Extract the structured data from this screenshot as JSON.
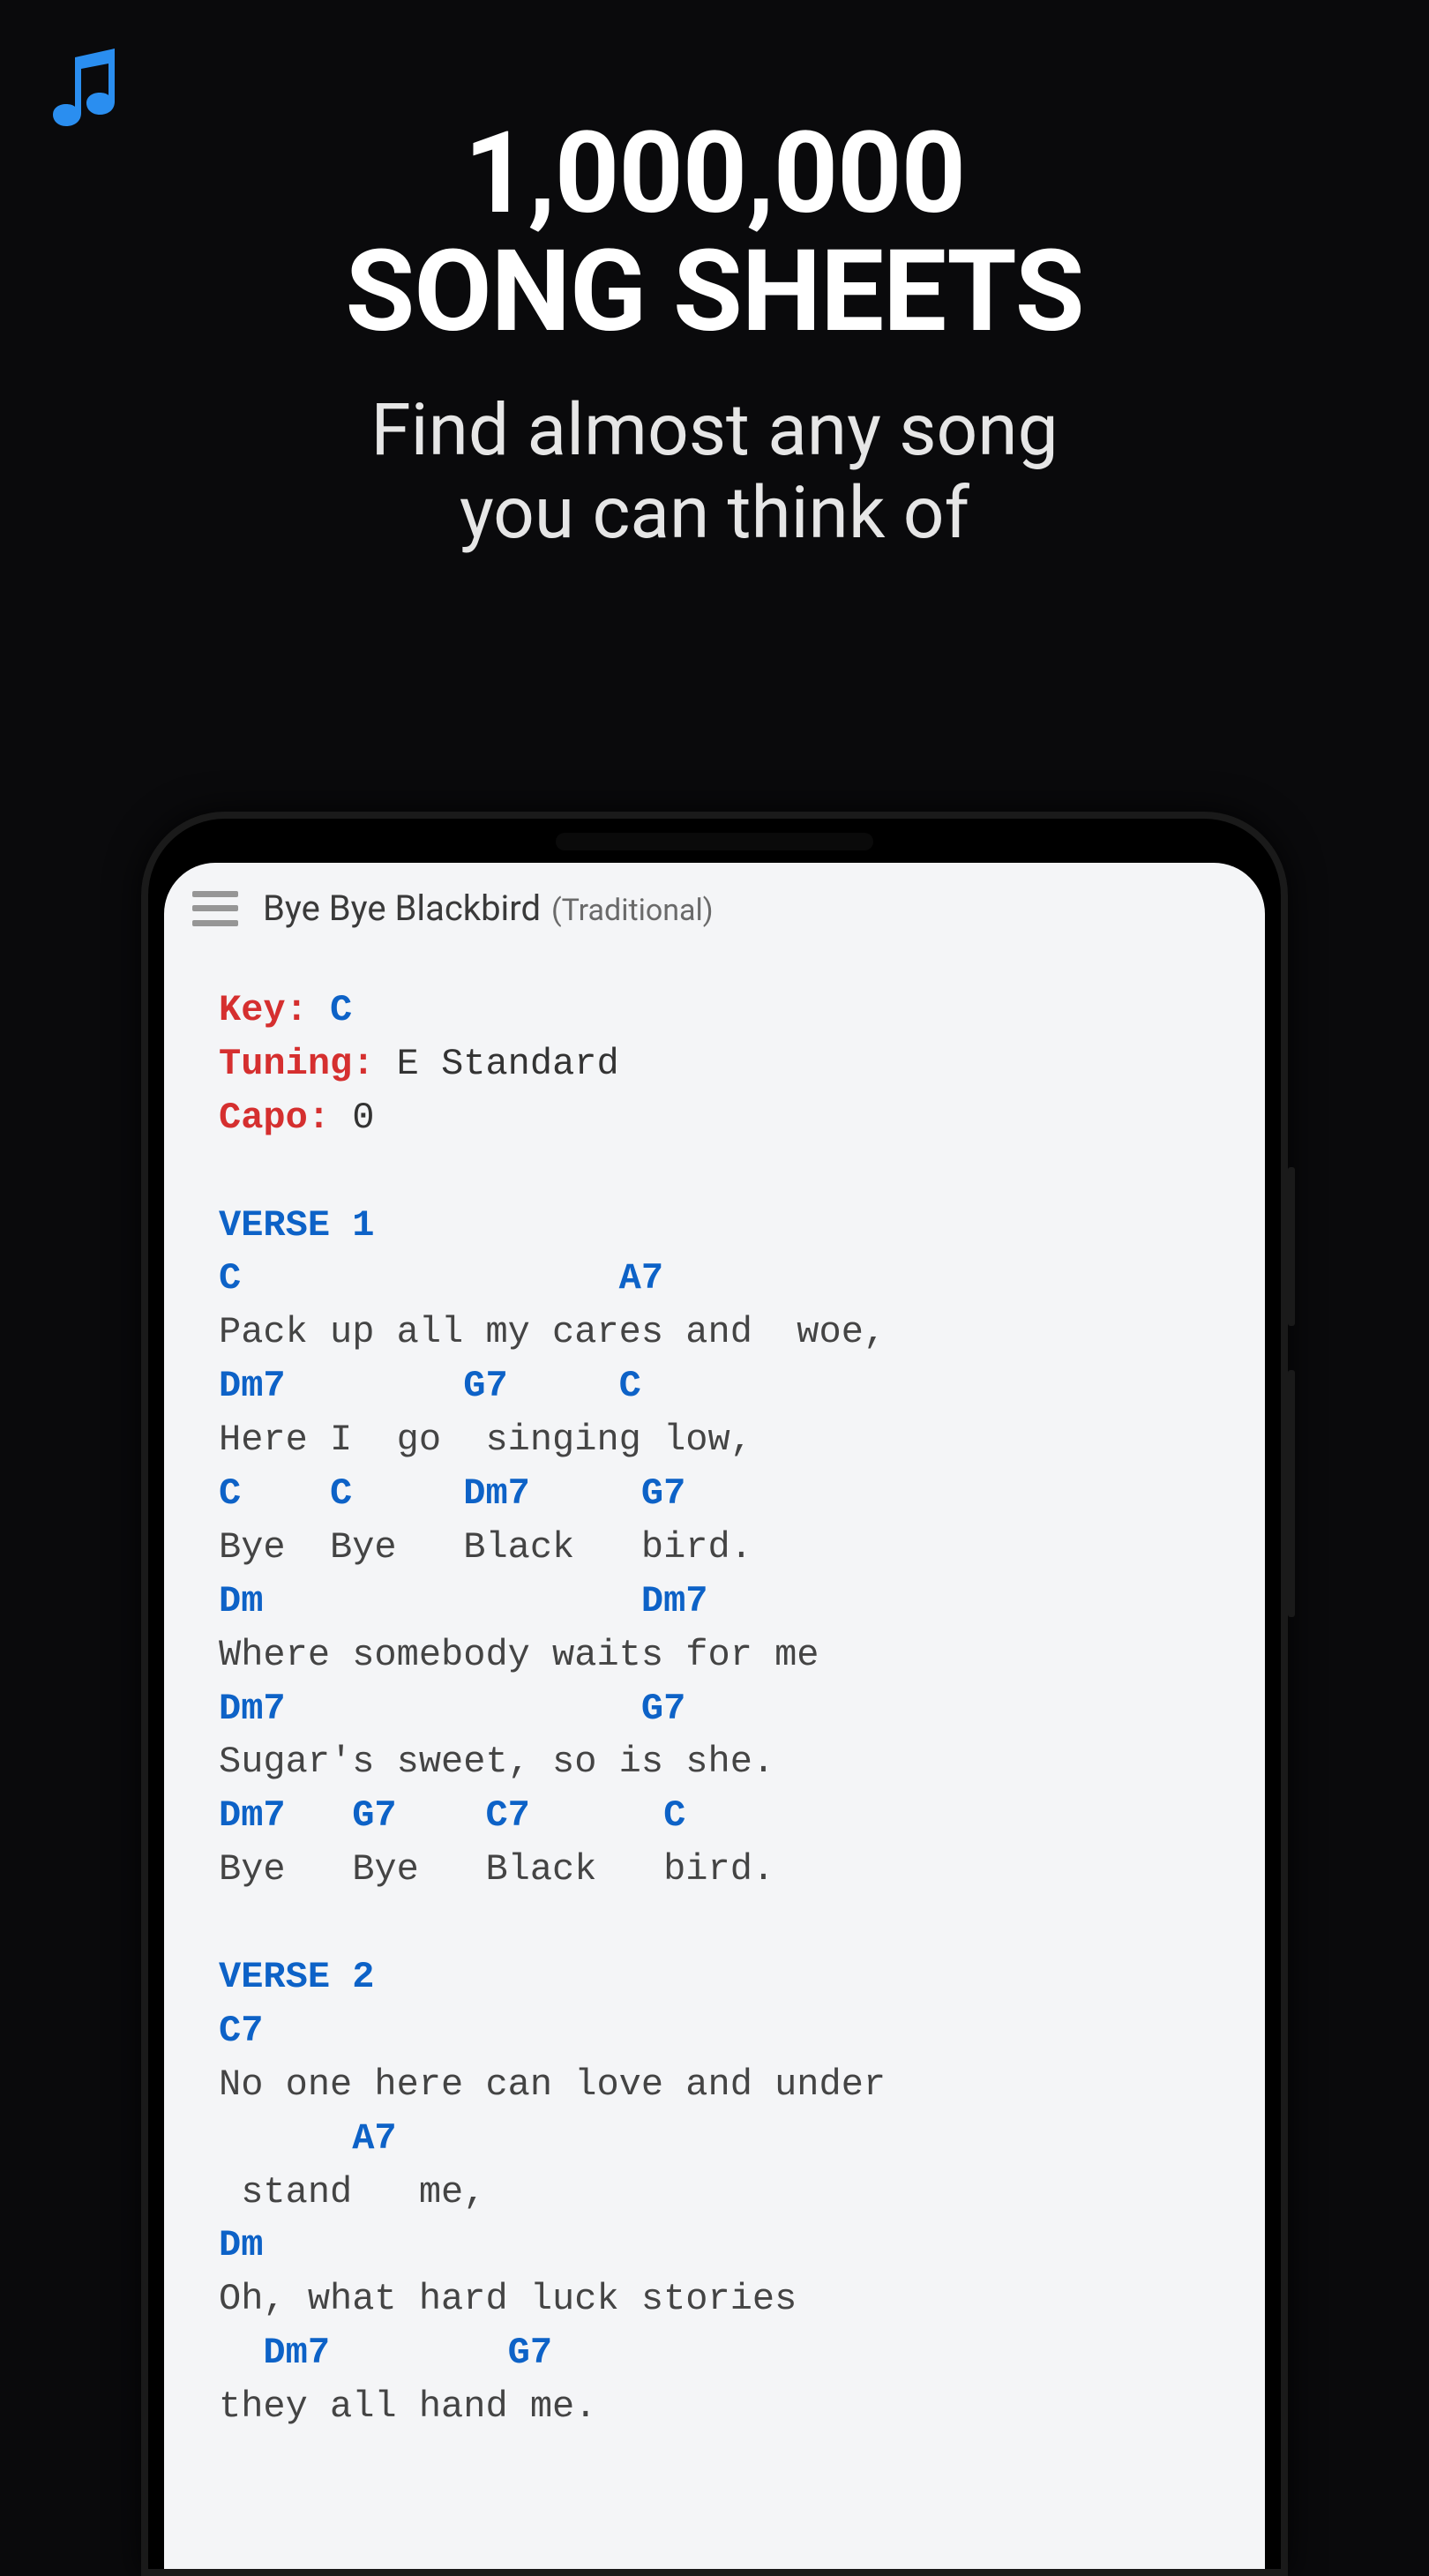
{
  "hero": {
    "title_line1": "1,000,000",
    "title_line2": "SONG SHEETS",
    "subtitle_line1": "Find almost any song",
    "subtitle_line2": "you can think of"
  },
  "app": {
    "song_title": "Bye Bye Blackbird",
    "song_subtitle": "(Traditional)"
  },
  "sheet": {
    "meta": {
      "key_label": "Key:",
      "key_value": "C",
      "tuning_label": "Tuning:",
      "tuning_value": "E Standard",
      "capo_label": "Capo:",
      "capo_value": "0"
    },
    "sections": [
      {
        "label": "VERSE 1",
        "lines": [
          {
            "chords": "C                 A7",
            "lyrics": "Pack up all my cares and  woe,"
          },
          {
            "chords": "Dm7        G7     C",
            "lyrics": "Here I  go  singing low,"
          },
          {
            "chords": "C    C     Dm7     G7",
            "lyrics": "Bye  Bye   Black   bird."
          },
          {
            "chords": "Dm                 Dm7",
            "lyrics": "Where somebody waits for me"
          },
          {
            "chords": "Dm7                G7",
            "lyrics": "Sugar's sweet, so is she."
          },
          {
            "chords": "Dm7   G7    C7      C",
            "lyrics": "Bye   Bye   Black   bird."
          }
        ]
      },
      {
        "label": "VERSE 2",
        "lines": [
          {
            "chords": "C7",
            "lyrics": "No one here can love and under"
          },
          {
            "chords": "      A7",
            "lyrics": " stand   me,"
          },
          {
            "chords": "Dm",
            "lyrics": "Oh, what hard luck stories"
          },
          {
            "chords": "  Dm7        G7",
            "lyrics": "they all hand me."
          }
        ]
      }
    ]
  }
}
